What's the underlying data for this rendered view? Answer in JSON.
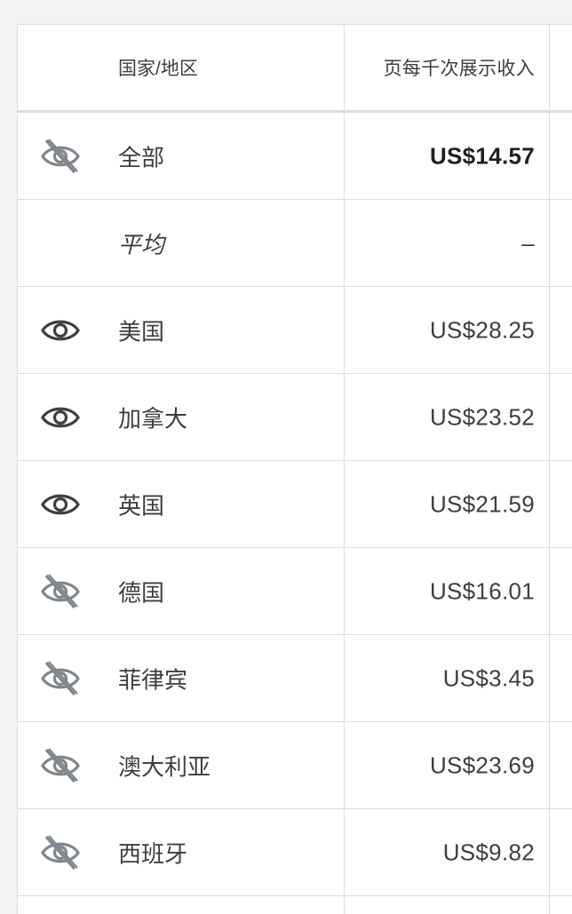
{
  "table": {
    "headers": {
      "country": "国家/地区",
      "rpm": "页每千次展示收入"
    },
    "rows": [
      {
        "country": "全部",
        "value": "US$14.57",
        "eye": "eye-off-icon",
        "style": "bold"
      },
      {
        "country": "平均",
        "value": "–",
        "eye": "",
        "style": "italic"
      },
      {
        "country": "美国",
        "value": "US$28.25",
        "eye": "eye-icon",
        "style": ""
      },
      {
        "country": "加拿大",
        "value": "US$23.52",
        "eye": "eye-icon",
        "style": ""
      },
      {
        "country": "英国",
        "value": "US$21.59",
        "eye": "eye-icon",
        "style": ""
      },
      {
        "country": "德国",
        "value": "US$16.01",
        "eye": "eye-off-icon",
        "style": ""
      },
      {
        "country": "菲律宾",
        "value": "US$3.45",
        "eye": "eye-off-icon",
        "style": ""
      },
      {
        "country": "澳大利亚",
        "value": "US$23.69",
        "eye": "eye-off-icon",
        "style": ""
      },
      {
        "country": "西班牙",
        "value": "US$9.82",
        "eye": "eye-off-icon",
        "style": ""
      }
    ]
  },
  "colors": {
    "text": "#3c4043",
    "icon_active": "#3c4043",
    "icon_muted": "#80868b",
    "border": "#dadce0",
    "background": "#f1f3f4"
  }
}
